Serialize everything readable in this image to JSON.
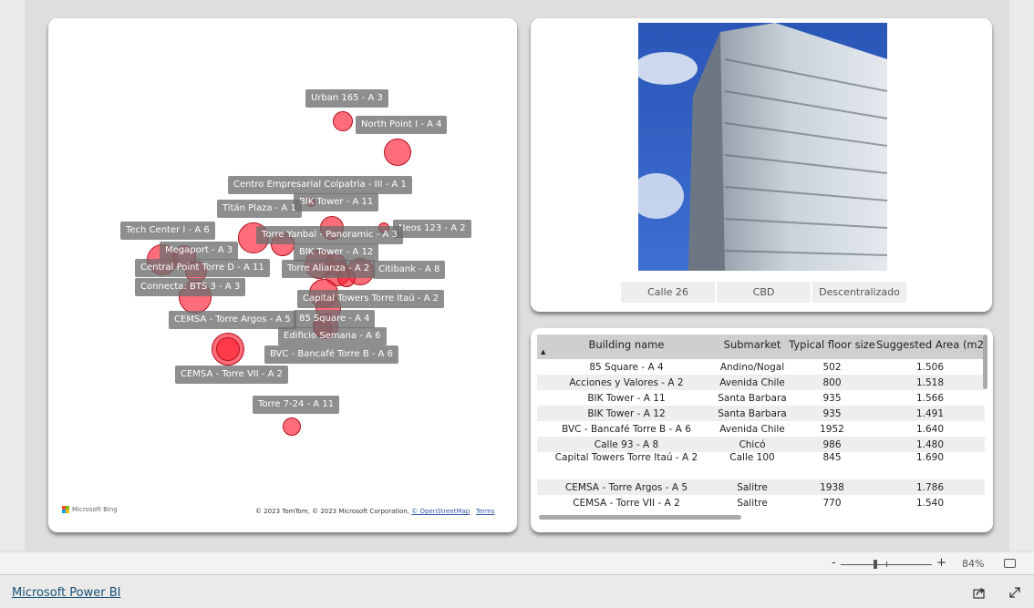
{
  "map": {
    "labels": [
      "Urban 165 - A 3",
      "North Point I - A 4",
      "Centro Empresarial Colpatria - III - A 1",
      "BIK Tower - A 11",
      "Titán Plaza - A 1",
      "Tech Center I - A 6",
      "Neos 123 - A 2",
      "Torre Yanbal - Panoramic - A 3",
      "Megaport - A 3",
      "BIK Tower - A 12",
      "Central Point Torre D - A 11",
      "Torre Alianza - A 2",
      "Citibank - A 8",
      "Connecta: BTS 3 - A 3",
      "Capital Towers Torre Itaú - A 2",
      "CEMSA - Torre Argos - A 5",
      "85 Square - A 4",
      "Edificio Semana - A 6",
      "BVC - Bancafé Torre B - A 6",
      "CEMSA - Torre VII - A 2",
      "Torre 7-24 - A 11"
    ],
    "bing_logo": "Microsoft Bing",
    "copyright": "© 2023 TomTom, © 2023 Microsoft Corporation, ",
    "osm": "© OpenStreetMap",
    "terms": "Terms",
    "bubble_color": "#ff1e32"
  },
  "image_panel": {
    "tags": [
      "Calle 26",
      "CBD",
      "Descentralizado"
    ]
  },
  "table": {
    "columns": [
      "Building name",
      "Submarket",
      "Typical floor size",
      "Suggested Area (m2"
    ],
    "rows": [
      [
        "85 Square - A 4",
        "Andino/Nogal",
        "502",
        "1.506"
      ],
      [
        "Acciones y Valores - A 2",
        "Avenida Chile",
        "800",
        "1.518"
      ],
      [
        "BIK Tower - A 11",
        "Santa Barbara",
        "935",
        "1.566"
      ],
      [
        "BIK Tower - A 12",
        "Santa Barbara",
        "935",
        "1.491"
      ],
      [
        "BVC - Bancafé Torre B - A 6",
        "Avenida Chile",
        "1952",
        "1.640"
      ],
      [
        "Calle 93 - A 8",
        "Chicó",
        "986",
        "1.480"
      ],
      [
        "Capital Towers Torre Itaú - A 2",
        "Calle 100",
        "845",
        "1.690"
      ],
      [
        "CEMSA - Torre Argos - A 5",
        "Salitre",
        "1938",
        "1.786"
      ],
      [
        "CEMSA - Torre VII - A 2",
        "Salitre",
        "770",
        "1.540"
      ]
    ]
  },
  "zoom": {
    "minus": "-",
    "plus": "+",
    "value": "84%",
    "level_percent": 84
  },
  "footer": {
    "brand": "Microsoft Power BI"
  }
}
